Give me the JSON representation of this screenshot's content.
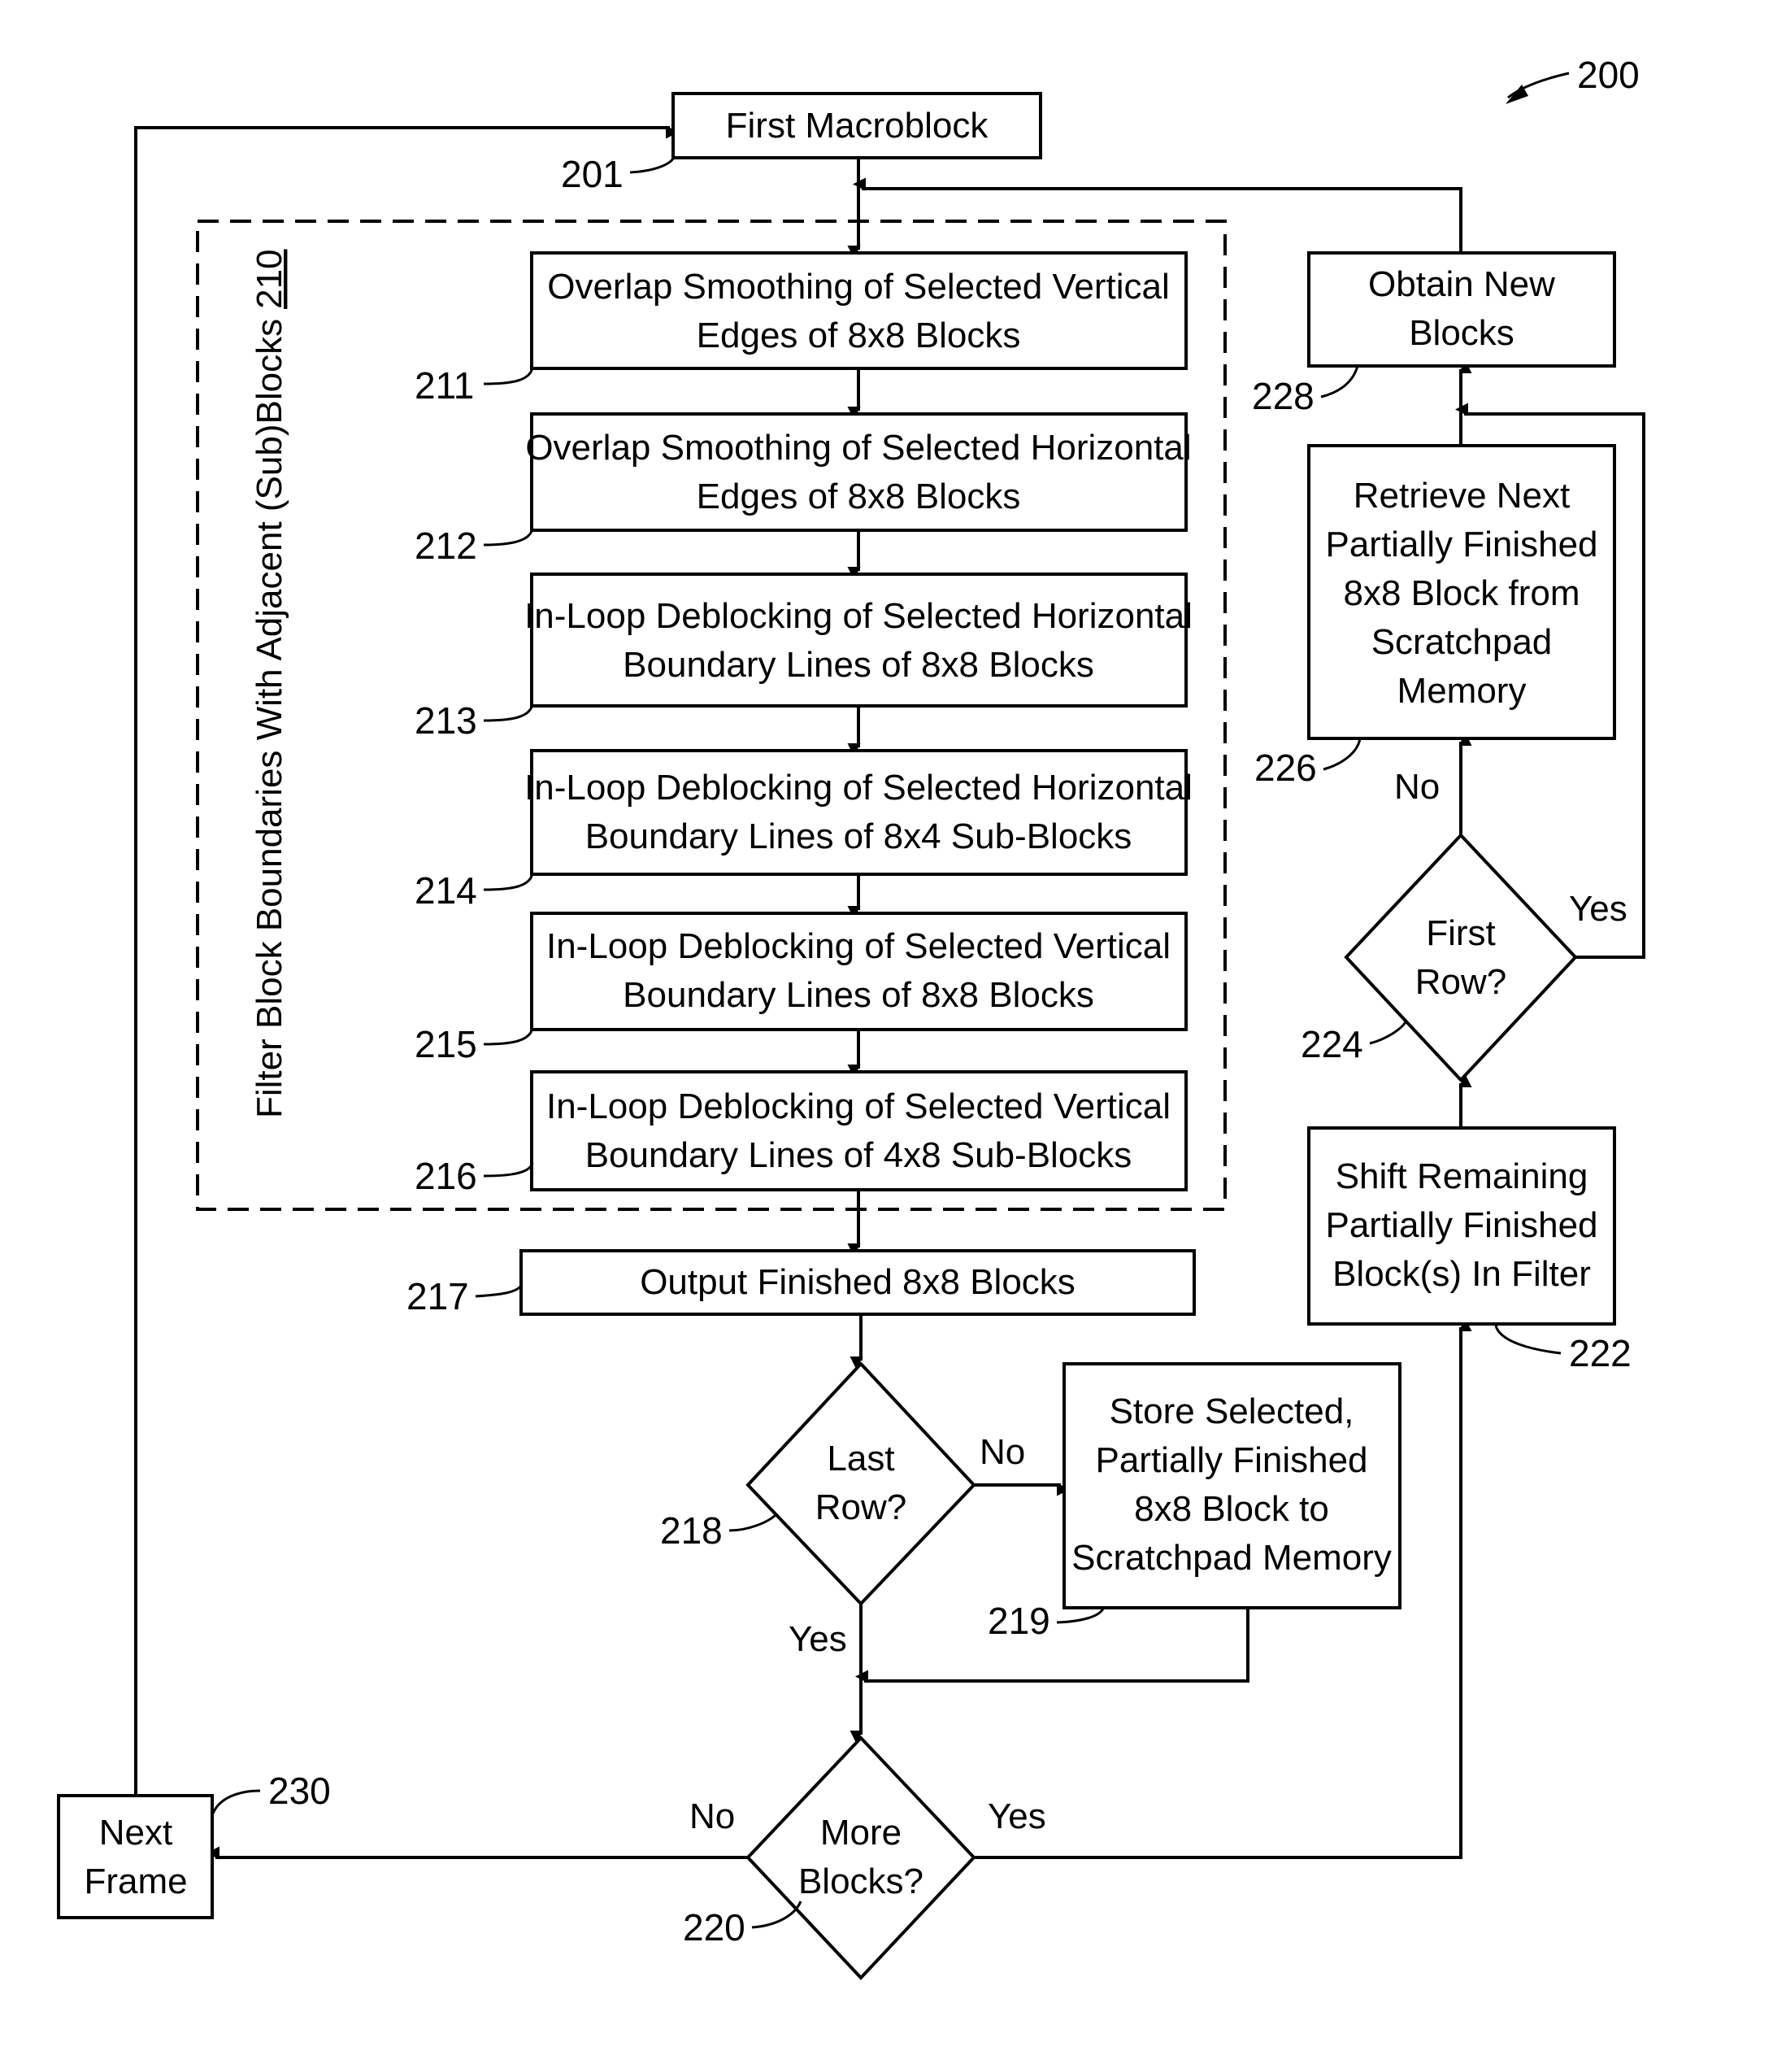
{
  "figure_ref": "200",
  "group": {
    "label": "Filter Block Boundaries With Adjacent (Sub)Blocks",
    "ref": "210"
  },
  "nodes": {
    "n201": {
      "ref": "201",
      "lines": [
        "First Macroblock"
      ]
    },
    "n211": {
      "ref": "211",
      "lines": [
        "Overlap Smoothing of Selected Vertical",
        "Edges of 8x8 Blocks"
      ]
    },
    "n212": {
      "ref": "212",
      "lines": [
        "Overlap Smoothing of Selected Horizontal",
        "Edges of 8x8 Blocks"
      ]
    },
    "n213": {
      "ref": "213",
      "lines": [
        "In-Loop Deblocking of Selected Horizontal",
        "Boundary Lines of 8x8 Blocks"
      ]
    },
    "n214": {
      "ref": "214",
      "lines": [
        "In-Loop Deblocking of Selected Horizontal",
        "Boundary Lines of 8x4 Sub-Blocks"
      ]
    },
    "n215": {
      "ref": "215",
      "lines": [
        "In-Loop Deblocking of Selected Vertical",
        "Boundary Lines of 8x8 Blocks"
      ]
    },
    "n216": {
      "ref": "216",
      "lines": [
        "In-Loop Deblocking of Selected Vertical",
        "Boundary Lines of 4x8 Sub-Blocks"
      ]
    },
    "n217": {
      "ref": "217",
      "lines": [
        "Output Finished 8x8 Blocks"
      ]
    },
    "n218": {
      "ref": "218",
      "lines": [
        "Last",
        "Row?"
      ]
    },
    "n219": {
      "ref": "219",
      "lines": [
        "Store Selected,",
        "Partially Finished",
        "8x8 Block to",
        "Scratchpad Memory"
      ]
    },
    "n220": {
      "ref": "220",
      "lines": [
        "More",
        "Blocks?"
      ]
    },
    "n222": {
      "ref": "222",
      "lines": [
        "Shift Remaining",
        "Partially Finished",
        "Block(s) In Filter"
      ]
    },
    "n224": {
      "ref": "224",
      "lines": [
        "First",
        "Row?"
      ]
    },
    "n226": {
      "ref": "226",
      "lines": [
        "Retrieve Next",
        "Partially Finished",
        "8x8 Block from",
        "Scratchpad",
        "Memory"
      ]
    },
    "n228": {
      "ref": "228",
      "lines": [
        "Obtain New",
        "Blocks"
      ]
    },
    "n230": {
      "ref": "230",
      "lines": [
        "Next",
        "Frame"
      ]
    }
  },
  "edge_labels": {
    "e218_no": "No",
    "e218_yes": "Yes",
    "e220_no": "No",
    "e220_yes": "Yes",
    "e224_no": "No",
    "e224_yes": "Yes"
  }
}
